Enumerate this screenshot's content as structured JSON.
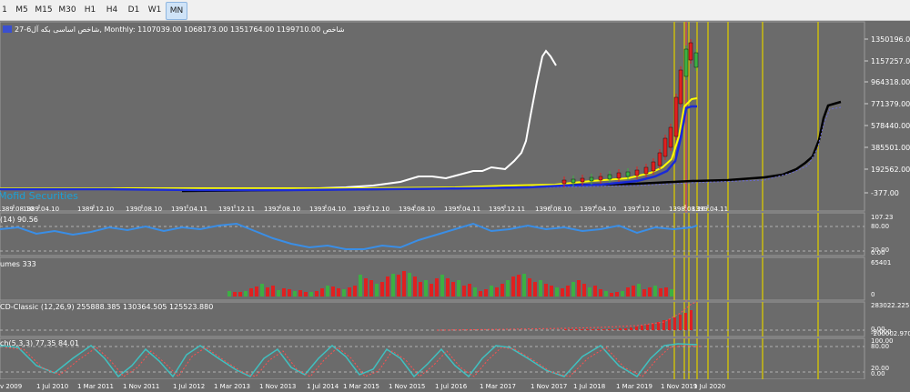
{
  "toolbar": {
    "timeframes": [
      {
        "label": "1",
        "active": false
      },
      {
        "label": "M5",
        "active": false
      },
      {
        "label": "M15",
        "active": false
      },
      {
        "label": "M30",
        "active": false
      },
      {
        "label": "H1",
        "active": false
      },
      {
        "label": "H4",
        "active": false
      },
      {
        "label": "D1",
        "active": false
      },
      {
        "label": "W1",
        "active": false
      },
      {
        "label": "MN",
        "active": true
      }
    ]
  },
  "main_chart": {
    "title": "27-6شاخص اساسی بکه آل, Monthly: 1107039.00 1068173.00 1351764.00 1199710.00 شاخص",
    "price_ticks": [
      "1350196.00",
      "1157257.00",
      "964318.00",
      "771379.00",
      "578440.00",
      "385501.00",
      "192562.00",
      "-377.00"
    ],
    "watermark": "Mofid Securities",
    "date_labels": [
      "1389.08.10",
      "1389.04.10",
      "1389.12.10",
      "1390.08.10",
      "1391.04.11",
      "1391.12.11",
      "1392.08.10",
      "1393.04.10",
      "1393.12.10",
      "1394.08.10",
      "1395.04.11",
      "1395.12.11",
      "1396.08.10",
      "1397.04.10",
      "1397.12.10",
      "1398.08.10",
      "1399.04.11"
    ]
  },
  "rsi": {
    "title": "(14) 90.56",
    "ticks": [
      "107.23",
      "80.00",
      "20.00",
      "0.00"
    ]
  },
  "volumes": {
    "title": "umes 333",
    "ticks": [
      "65401",
      "0"
    ]
  },
  "macd": {
    "title": "CD-Classic (12,26,9) 255888.385 130364.505 125523.880",
    "ticks": [
      "283022.225",
      "0.00",
      "-0.000",
      "-200002.970"
    ]
  },
  "stoch": {
    "title": "ch(5,3,3) 77.35 84.01",
    "ticks": [
      "100.00",
      "80.00",
      "20.00",
      "0.00"
    ]
  },
  "time_axis": [
    "v 2009",
    "1 Jul 2010",
    "1 Mar 2011",
    "1 Nov 2011",
    "1 Jul 2012",
    "1 Mar 2013",
    "1 Nov 2013",
    "1 Jul 2014",
    "1 Mar 2015",
    "1 Nov 2015",
    "1 Jul 2016",
    "1 Mar 2017",
    "1 Nov 2017",
    "1 Jul 2018",
    "1 Mar 2019",
    "1 Nov 2019",
    "1 Jul 2020"
  ],
  "colors": {
    "background": "#6b6b6b",
    "grid": "#8a8a8a",
    "axis_text": "#ffffff",
    "bull_candle": "#3cb043",
    "bear_candle": "#e02020",
    "yellow_line": "#ffff00",
    "blue_line": "#1a2ad8",
    "white_line": "#ffffff",
    "black_line": "#000000",
    "rsi_line": "#3a8ee6",
    "macd_signal": "#ff5050",
    "vline": "#d8c800"
  }
}
